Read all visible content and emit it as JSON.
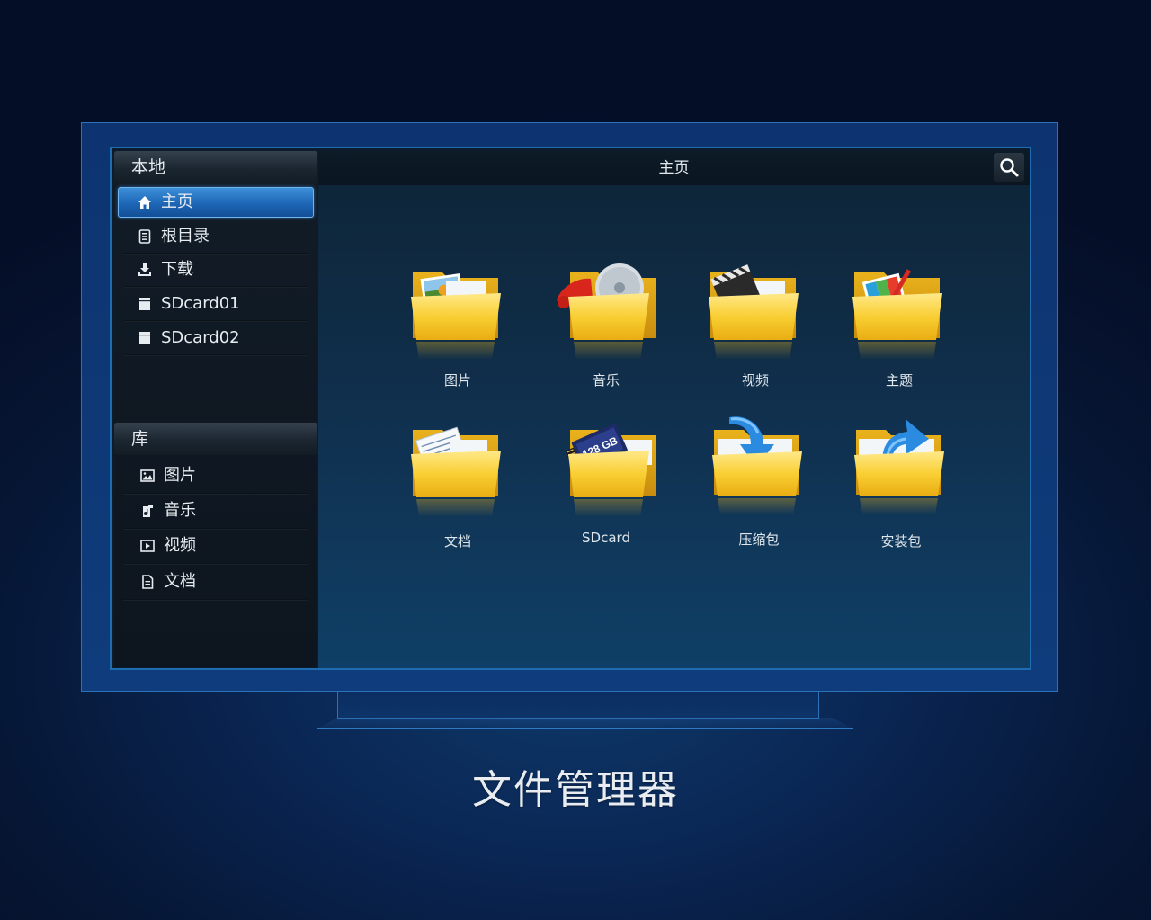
{
  "window_title": "文件管理器",
  "sidebar": {
    "local_header": "本地",
    "local_items": [
      {
        "label": "主页",
        "icon": "home-icon",
        "active": true
      },
      {
        "label": "根目录",
        "icon": "document-list-icon",
        "active": false
      },
      {
        "label": "下载",
        "icon": "download-icon",
        "active": false
      },
      {
        "label": "SDcard01",
        "icon": "sdcard-icon",
        "active": false
      },
      {
        "label": "SDcard02",
        "icon": "sdcard-icon",
        "active": false
      }
    ],
    "library_header": "库",
    "library_items": [
      {
        "label": "图片",
        "icon": "image-icon"
      },
      {
        "label": "音乐",
        "icon": "music-icon"
      },
      {
        "label": "视频",
        "icon": "video-icon"
      },
      {
        "label": "文档",
        "icon": "document-icon"
      }
    ]
  },
  "main": {
    "title": "主页",
    "search_icon": "search-icon",
    "folders": [
      {
        "label": "图片",
        "icon": "pictures-folder-icon"
      },
      {
        "label": "音乐",
        "icon": "music-folder-icon"
      },
      {
        "label": "视频",
        "icon": "video-folder-icon"
      },
      {
        "label": "主题",
        "icon": "theme-folder-icon"
      },
      {
        "label": "文档",
        "icon": "documents-folder-icon"
      },
      {
        "label": "SDcard",
        "icon": "sdcard-folder-icon",
        "card_text": "128 GB"
      },
      {
        "label": "压缩包",
        "icon": "archive-folder-icon"
      },
      {
        "label": "安装包",
        "icon": "installer-folder-icon"
      }
    ]
  },
  "colors": {
    "accent": "#1d66b6",
    "folder_yellow": "#f6c92b",
    "background": "#061634"
  }
}
